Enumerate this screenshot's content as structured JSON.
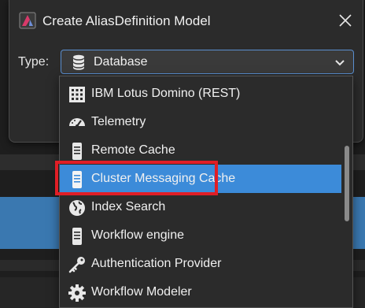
{
  "dialog": {
    "title": "Create AliasDefinition Model",
    "app_icon": "app-logo-icon",
    "close_icon": "close-icon"
  },
  "type_field": {
    "label": "Type:",
    "selected_value": "Database",
    "selected_icon": "database-icon"
  },
  "dropdown": {
    "items": [
      {
        "label": "IBM Lotus Domino (REST)",
        "icon": "building-icon"
      },
      {
        "label": "Telemetry",
        "icon": "gauge-icon"
      },
      {
        "label": "Remote Cache",
        "icon": "server-icon"
      },
      {
        "label": "Cluster Messaging Cache",
        "icon": "server-icon",
        "selected": true
      },
      {
        "label": "Index Search",
        "icon": "globe-icon"
      },
      {
        "label": "Workflow engine",
        "icon": "server-icon"
      },
      {
        "label": "Authentication Provider",
        "icon": "key-icon"
      },
      {
        "label": "Workflow Modeler",
        "icon": "gear-icon"
      }
    ]
  },
  "colors": {
    "selection": "#3c8bd9",
    "highlight": "#e01e26"
  }
}
